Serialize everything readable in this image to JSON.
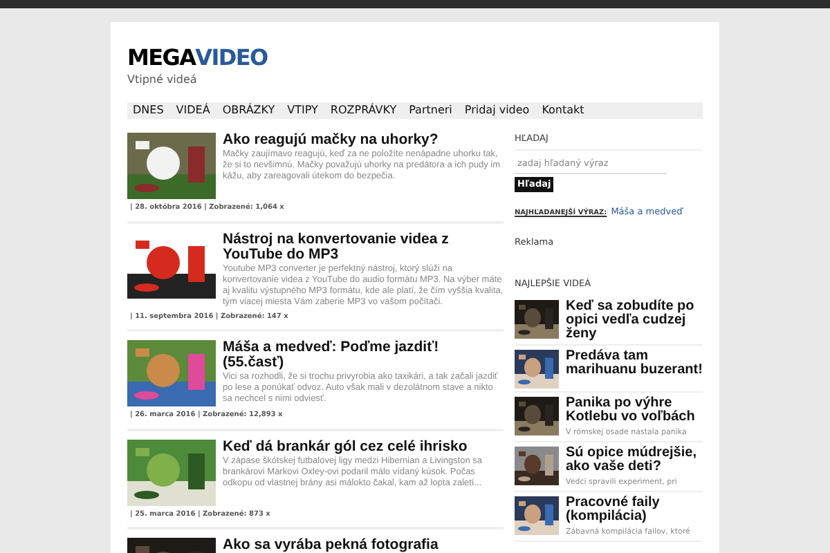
{
  "site": {
    "logo_dark": "MEGA",
    "logo_accent": "VIDEO",
    "tagline": "Vtipné videá"
  },
  "nav": [
    "DNES",
    "VIDEÁ",
    "OBRÁZKY",
    "VTIPY",
    "ROZPRÁVKY",
    "Partneri",
    "Pridaj video",
    "Kontakt"
  ],
  "posts": [
    {
      "title": "Ako reagujú mačky na uhorky?",
      "excerpt": "Mačky zaujímavo reagujú, keď za ne položíte nenápadne uhorku tak, že si to nevšimnú. Mačky považujú uhorky na predátora a ich pudy im kážu, aby zareagovali útekom do bezpečia.",
      "meta": "| 28. októbra 2016 | Zobrazené: 1,064 x"
    },
    {
      "title": "Nástroj na konvertovanie videa z YouTube do MP3",
      "excerpt": "Youtube MP3 converter je perfektný nástroj, ktorý slúži na konvertovanie videa z YouTube do audio formátu MP3. Na výber máte aj kvalitu výstupného MP3 formátu, kde ale platí, že čím vyššia kvalita, tým viacej miesta Vám zaberie MP3 vo vašom počítači.",
      "meta": "| 11. septembra 2016 | Zobrazené: 147 x"
    },
    {
      "title": "Máša a medveď: Poďme jazdiť! (55.časť)",
      "excerpt": "Vici sa rozhodli, že si trochu privyrobia ako taxikári, a tak začali jazdiť po lese a ponúkať odvoz. Auto však mali v dezolátnom stave a nikto sa nechcel s nimi odviesť.",
      "meta": "| 26. marca 2016 | Zobrazené: 12,893 x"
    },
    {
      "title": "Keď dá brankár gól cez celé ihrisko",
      "excerpt": "V zápase škótskej futbalovej ligy medzi Hibernian a Livingston sa brankárovi Markovi Oxley-ovi podaril málo vídaný kúsok. Počas odkopu od vlastnej brány asi málokto čakal, kam až lopta zaletí...",
      "meta": "| 25. marca 2016 | Zobrazené: 873 x"
    },
    {
      "title": "Ako sa vyrába pekná fotografia"
    }
  ],
  "sidebar": {
    "search_heading": "HĽADAJ",
    "search": {
      "placeholder": "zadaj hľadaný výraz"
    },
    "search_button": "Hľadaj",
    "top_term_label": "NAJHĽADANEJŠÍ VÝRAZ:",
    "top_term": "Máša a medveď",
    "ad_heading": "Reklama",
    "best_heading": "NAJLEPŠIE VIDEÁ",
    "best": [
      {
        "title": "Keď sa zobudíte po opici vedľa cudzej ženy"
      },
      {
        "title": "Predáva tam marihuanu buzerant!"
      },
      {
        "title": "Panika po výhre Kotlebu vo voľbách",
        "excerpt": "V rómskej osade nastala panika"
      },
      {
        "title": "Sú opice múdrejšie, ako vaše deti?",
        "excerpt": "Vedci spravili experiment, pri"
      },
      {
        "title": "Pracovné faily (kompilácia)",
        "excerpt": "Zábavná kompilácia failov, ktoré"
      }
    ]
  }
}
